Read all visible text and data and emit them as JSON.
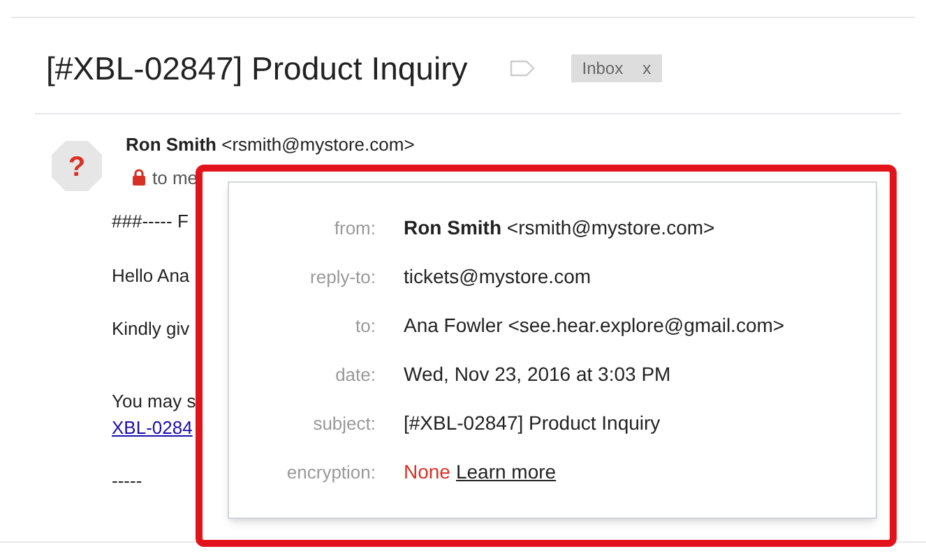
{
  "subject": "[#XBL-02847] Product Inquiry",
  "labels": [
    {
      "text": "Inbox",
      "remove": "x"
    }
  ],
  "avatar": "?",
  "sender": "**Ron Smith** <rsmith@mystore.com>",
  "recipient": "to me",
  "body": [
    {
      "kind": "text",
      "text": "###----- F"
    },
    {
      "kind": "text",
      "text": "Hello Ana"
    },
    {
      "kind": "text",
      "text": "Kindly giv"
    },
    {
      "kind": "text",
      "text": "You may s"
    },
    {
      "kind": "link",
      "text": "XBL-0284"
    },
    {
      "kind": "text",
      "text": "-----"
    }
  ],
  "details": [
    {
      "kind": "text",
      "label": "from:",
      "value": "**Ron Smith** <rsmith@mystore.com>"
    },
    {
      "kind": "text",
      "label": "reply-to:",
      "value": "tickets@mystore.com"
    },
    {
      "kind": "text",
      "label": "to:",
      "value": "Ana Fowler <see.hear.explore@gmail.com>"
    },
    {
      "kind": "text",
      "label": "date:",
      "value": "Wed, Nov 23, 2016 at 3:03 PM"
    },
    {
      "kind": "text",
      "label": "subject:",
      "value": "[#XBL-02847] Product Inquiry"
    },
    {
      "kind": "encryption",
      "label": "encryption:",
      "value": "None",
      "link": "Learn more"
    }
  ]
}
